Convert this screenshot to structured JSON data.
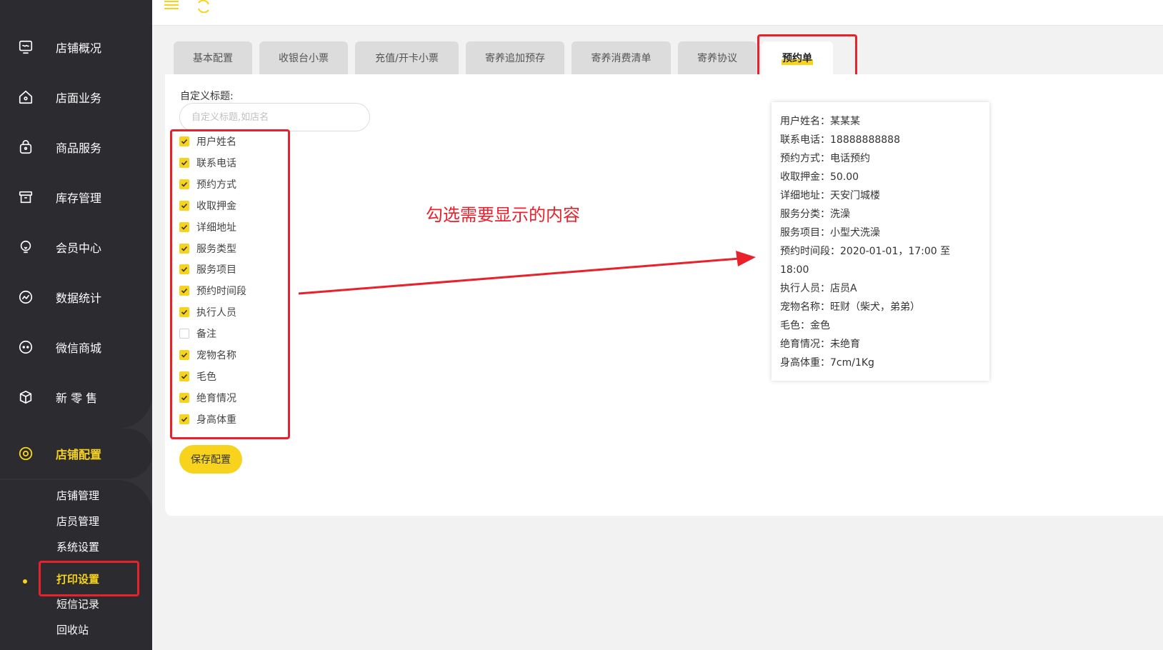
{
  "sidebar": {
    "items": [
      {
        "label": "店铺概况",
        "icon": "monitor-icon"
      },
      {
        "label": "店面业务",
        "icon": "home-icon"
      },
      {
        "label": "商品服务",
        "icon": "bag-icon"
      },
      {
        "label": "库存管理",
        "icon": "box-icon"
      },
      {
        "label": "会员中心",
        "icon": "member-icon"
      },
      {
        "label": "数据统计",
        "icon": "chart-icon"
      },
      {
        "label": "微信商城",
        "icon": "chat-icon"
      },
      {
        "label": "新 零 售",
        "icon": "cube-icon"
      },
      {
        "label": "店铺配置",
        "icon": "settings-circle-icon"
      }
    ],
    "sub_items": [
      "店铺管理",
      "店员管理",
      "系统设置",
      "打印设置",
      "短信记录",
      "回收站"
    ],
    "active_sub": "打印设置"
  },
  "tabs": [
    "基本配置",
    "收银台小票",
    "充值/开卡小票",
    "寄养追加预存",
    "寄养消费清单",
    "寄养协议",
    "预约单"
  ],
  "active_tab": "预约单",
  "form": {
    "title_label": "自定义标题:",
    "title_placeholder": "自定义标题,如店名",
    "title_value": "",
    "fields": [
      {
        "label": "用户姓名",
        "checked": true
      },
      {
        "label": "联系电话",
        "checked": true
      },
      {
        "label": "预约方式",
        "checked": true
      },
      {
        "label": "收取押金",
        "checked": true
      },
      {
        "label": "详细地址",
        "checked": true
      },
      {
        "label": "服务类型",
        "checked": true
      },
      {
        "label": "服务项目",
        "checked": true
      },
      {
        "label": "预约时间段",
        "checked": true
      },
      {
        "label": "执行人员",
        "checked": true
      },
      {
        "label": "备注",
        "checked": false
      },
      {
        "label": "宠物名称",
        "checked": true
      },
      {
        "label": "毛色",
        "checked": true
      },
      {
        "label": "绝育情况",
        "checked": true
      },
      {
        "label": "身高体重",
        "checked": true
      }
    ],
    "save_label": "保存配置"
  },
  "annotation": "勾选需要显示的内容",
  "preview": {
    "lines": [
      "用户姓名：某某某",
      "联系电话：18888888888",
      "预约方式：电话预约",
      "收取押金：50.00",
      "详细地址：天安门城楼",
      "服务分类：洗澡",
      "服务项目：小型犬洗澡",
      "预约时间段：2020-01-01，17:00 至\n18:00",
      "执行人员：店员A",
      "宠物名称：旺财（柴犬，弟弟）",
      "毛色：金色",
      "绝育情况：未绝育",
      "身高体重：7cm/1Kg"
    ]
  },
  "colors": {
    "accent": "#f7d31d",
    "sidebar_bg": "#333338",
    "highlight_red": "#e8212b"
  }
}
